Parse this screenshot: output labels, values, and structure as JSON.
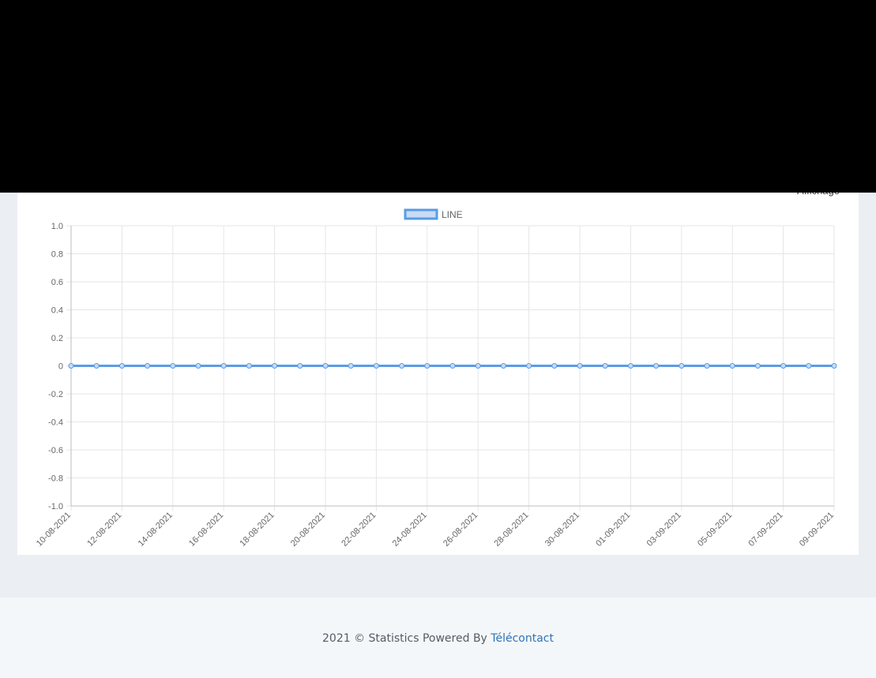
{
  "card": {
    "action_label": "Affichage"
  },
  "footer": {
    "text": "2021 © Statistics Powered By",
    "link_label": "Télécontact"
  },
  "colors": {
    "line": "#5a9be6",
    "point_fill": "#c7dcf5",
    "grid": "#e6e6e6",
    "axis_text": "#666666"
  },
  "chart_data": {
    "type": "line",
    "title": "",
    "xlabel": "",
    "ylabel": "",
    "ylim": [
      -1.0,
      1.0
    ],
    "y_ticks": [
      "1.0",
      "0.8",
      "0.6",
      "0.4",
      "0.2",
      "0",
      "-0.2",
      "-0.4",
      "-0.6",
      "-0.8",
      "-1.0"
    ],
    "legend_position": "top-center",
    "grid": true,
    "x_tick_labels": [
      "10-08-2021",
      "12-08-2021",
      "14-08-2021",
      "16-08-2021",
      "18-08-2021",
      "20-08-2021",
      "22-08-2021",
      "24-08-2021",
      "26-08-2021",
      "28-08-2021",
      "30-08-2021",
      "01-09-2021",
      "03-09-2021",
      "05-09-2021",
      "07-09-2021",
      "09-09-2021"
    ],
    "x": [
      "10-08-2021",
      "11-08-2021",
      "12-08-2021",
      "13-08-2021",
      "14-08-2021",
      "15-08-2021",
      "16-08-2021",
      "17-08-2021",
      "18-08-2021",
      "19-08-2021",
      "20-08-2021",
      "21-08-2021",
      "22-08-2021",
      "23-08-2021",
      "24-08-2021",
      "25-08-2021",
      "26-08-2021",
      "27-08-2021",
      "28-08-2021",
      "29-08-2021",
      "30-08-2021",
      "31-08-2021",
      "01-09-2021",
      "02-09-2021",
      "03-09-2021",
      "04-09-2021",
      "05-09-2021",
      "06-09-2021",
      "07-09-2021",
      "08-09-2021",
      "09-09-2021"
    ],
    "series": [
      {
        "name": "LINE",
        "values": [
          0,
          0,
          0,
          0,
          0,
          0,
          0,
          0,
          0,
          0,
          0,
          0,
          0,
          0,
          0,
          0,
          0,
          0,
          0,
          0,
          0,
          0,
          0,
          0,
          0,
          0,
          0,
          0,
          0,
          0,
          0
        ]
      }
    ]
  }
}
